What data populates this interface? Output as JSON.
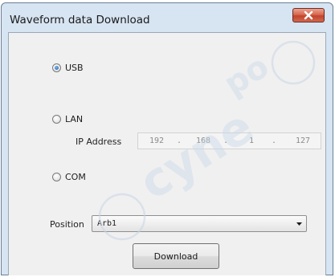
{
  "window": {
    "title": "Waveform data Download",
    "close_icon": "close-icon"
  },
  "connection": {
    "usb_label": "USB",
    "usb_selected": true,
    "lan_label": "LAN",
    "lan_selected": false,
    "com_label": "COM",
    "com_selected": false
  },
  "ip": {
    "label": "IP Address",
    "octets": [
      "192",
      "168",
      "1",
      "127"
    ],
    "separators": [
      ".",
      ".",
      "."
    ]
  },
  "position": {
    "label": "Position",
    "selected": "Arb1"
  },
  "actions": {
    "download_label": "Download"
  },
  "colors": {
    "dialog_frame": "#d7e4f2",
    "client_background": "#f0f0f0",
    "close_button": "#c2432b"
  }
}
